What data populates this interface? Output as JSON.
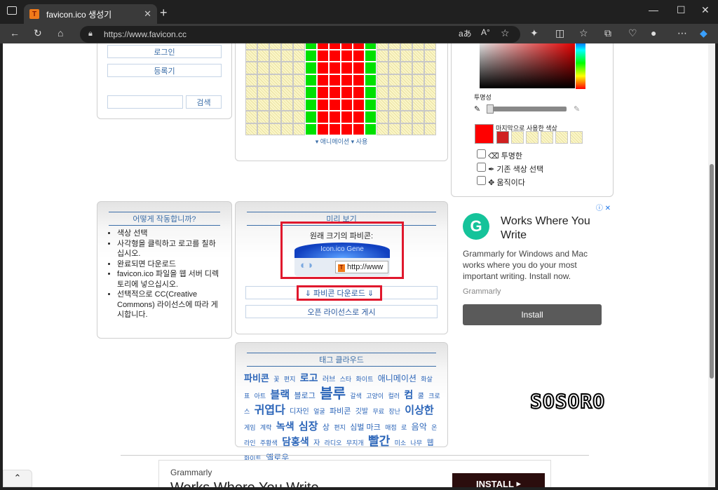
{
  "browser": {
    "tab_title": "favicon.ico 생성기",
    "tab_icon": "T",
    "url": "https://www.favicon.cc"
  },
  "login": {
    "login_label": "로그인",
    "register_label": "등록기",
    "search_label": "검색"
  },
  "editor": {
    "animation_link": "▾ 애니메이션 ▾ 사용"
  },
  "color_panel": {
    "opacity_label": "투명성",
    "last_used_label": "마지막으로 사용한 색상",
    "transparent_label": "투명한",
    "pick_color_label": "기존 색상 선택",
    "move_label": "움직이다",
    "current_color": "#ff0000",
    "last_used_color": "#d02020"
  },
  "howto": {
    "title": "어떻게 작동합니까?",
    "steps": [
      "색상 선택",
      "사각형을 클릭하고 로고를 칠하십시오.",
      "완료되면 다운로드",
      "favicon.ico 파일을 웹 서버 디렉토리에 넣으십시오.",
      "선택적으로 CC(Creative Commons) 라이선스에 따라 게시합니다."
    ]
  },
  "preview": {
    "title": "미리 보기",
    "original_size": "원래 크기의 파비콘:",
    "banner_text": "Icon.ico Gene",
    "address_text": "http://www",
    "download_label": "⇓ 파비콘 다운로드 ⇓",
    "publish_label": "오픈 라이선스로 게시"
  },
  "ad_side": {
    "heading": "Works Where You Write",
    "body": "Grammarly for Windows and Mac works where you do your most important writing. Install now.",
    "brand": "Grammarly",
    "install": "Install"
  },
  "tag_cloud": {
    "title": "태그 클라우드",
    "tags": [
      {
        "t": "파비콘",
        "s": 13
      },
      {
        "t": "꽃",
        "s": 9
      },
      {
        "t": "편지",
        "s": 9
      },
      {
        "t": "로고",
        "s": 14
      },
      {
        "t": "러브",
        "s": 10
      },
      {
        "t": "스타",
        "s": 9
      },
      {
        "t": "화이트",
        "s": 9
      },
      {
        "t": "애니메이션",
        "s": 12
      },
      {
        "t": "화살표",
        "s": 9
      },
      {
        "t": "아트",
        "s": 9
      },
      {
        "t": "블랙",
        "s": 15
      },
      {
        "t": "블로그",
        "s": 11
      },
      {
        "t": "블루",
        "s": 20
      },
      {
        "t": "갈색",
        "s": 9
      },
      {
        "t": "고양이",
        "s": 9
      },
      {
        "t": "컬러",
        "s": 9
      },
      {
        "t": "컴",
        "s": 14
      },
      {
        "t": "쿨",
        "s": 10
      },
      {
        "t": "크로스",
        "s": 9
      },
      {
        "t": "귀엽다",
        "s": 16
      },
      {
        "t": "디자인",
        "s": 10
      },
      {
        "t": "얼굴",
        "s": 9
      },
      {
        "t": "파비콘",
        "s": 11
      },
      {
        "t": "깃발",
        "s": 10
      },
      {
        "t": "무료",
        "s": 9
      },
      {
        "t": "장난",
        "s": 9
      },
      {
        "t": "이상한",
        "s": 15
      },
      {
        "t": "게임",
        "s": 9
      },
      {
        "t": "계략",
        "s": 9
      },
      {
        "t": "녹색",
        "s": 14
      },
      {
        "t": "심장",
        "s": 15
      },
      {
        "t": "상",
        "s": 11
      },
      {
        "t": "편지",
        "s": 9
      },
      {
        "t": "심벌 마크",
        "s": 11
      },
      {
        "t": "매점",
        "s": 9
      },
      {
        "t": "로",
        "s": 9
      },
      {
        "t": "음악",
        "s": 12
      },
      {
        "t": "온라인",
        "s": 9
      },
      {
        "t": "주황색",
        "s": 9
      },
      {
        "t": "담홍색",
        "s": 14
      },
      {
        "t": "자",
        "s": 10
      },
      {
        "t": "라디오",
        "s": 9
      },
      {
        "t": "무지개",
        "s": 9
      },
      {
        "t": "빨간",
        "s": 17
      },
      {
        "t": "미소",
        "s": 9
      },
      {
        "t": "나무",
        "s": 9
      },
      {
        "t": "웹",
        "s": 11
      },
      {
        "t": "화이트",
        "s": 9
      },
      {
        "t": "옐로우",
        "s": 12
      }
    ]
  },
  "ad_bottom": {
    "brand": "Grammarly",
    "heading": "Works Where You Write",
    "install": "INSTALL"
  },
  "watermark": "SOSORO"
}
